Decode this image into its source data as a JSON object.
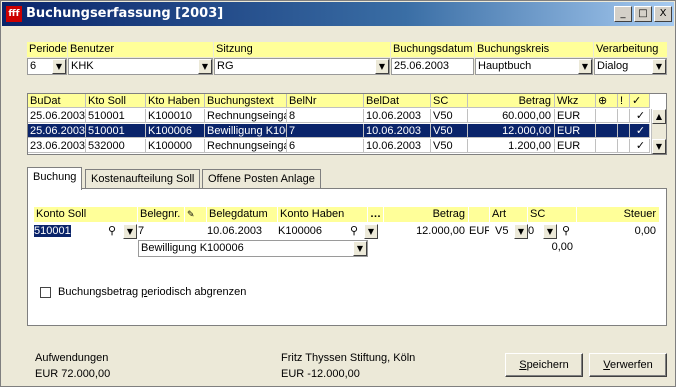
{
  "window": {
    "title": "Buchungserfassung [2003]",
    "app_icon": "fff"
  },
  "controls": {
    "minimize": "_",
    "maximize": "□",
    "close": "X"
  },
  "header": {
    "labels": [
      "Periode",
      "Benutzer",
      "Sitzung",
      "Buchungsdatum",
      "Buchungskreis",
      "Verarbeitung"
    ],
    "periode": "6",
    "benutzer": "KHK",
    "sitzung": "RG",
    "buchungsdatum": "25.06.2003",
    "buchungskreis": "Hauptbuch",
    "verarbeitung": "Dialog"
  },
  "grid": {
    "columns": [
      "BuDat",
      "Kto Soll",
      "Kto Haben",
      "Buchungstext",
      "BelNr",
      "BelDat",
      "SC",
      "Betrag",
      "Wkz",
      "⊕",
      "!",
      "✓"
    ],
    "rows": [
      [
        "25.06.2003",
        "510001",
        "K100010",
        "Rechnungseingan",
        "8",
        "10.06.2003",
        "V50",
        "60.000,00",
        "EUR",
        "",
        "",
        "✓"
      ],
      [
        "25.06.2003",
        "510001",
        "K100006",
        "Bewilligung K1000",
        "7",
        "10.06.2003",
        "V50",
        "12.000,00",
        "EUR",
        "",
        "",
        "✓"
      ],
      [
        "23.06.2003",
        "532000",
        "K100000",
        "Rechnungseingan",
        "6",
        "10.06.2003",
        "V50",
        "1.200,00",
        "EUR",
        "",
        "",
        "✓"
      ]
    ]
  },
  "tabs": [
    {
      "label": "Buchung"
    },
    {
      "label": "Kostenaufteilung Soll"
    },
    {
      "label": "Offene Posten Anlage"
    }
  ],
  "form": {
    "labels": {
      "konto_soll": "Konto Soll",
      "belegnr": "Belegnr.",
      "belegdatum": "Belegdatum",
      "konto_haben": "Konto Haben",
      "betrag": "Betrag",
      "art": "Art",
      "sc": "SC",
      "steuer": "Steuer"
    },
    "konto_soll": "510001",
    "belegnr": "7",
    "belegdatum": "10.06.2003",
    "konto_haben": "K100006",
    "betrag": "12.000,00",
    "wkz": "EUR",
    "art": "V5",
    "sc": "0",
    "steuer": "0,00",
    "buchungstext": "Bewilligung K100006",
    "sc_amount": "0,00",
    "checkbox_label_pre": "Buchungsbetrag ",
    "checkbox_label_u": "p",
    "checkbox_label_post": "eriodisch abgrenzen"
  },
  "footer": {
    "left_label": "Aufwendungen",
    "left_value": "EUR 72.000,00",
    "center_label": "Fritz Thyssen Stiftung, Köln",
    "center_value": "EUR -12.000,00",
    "save_u": "S",
    "save_rest": "peichern",
    "discard_u": "V",
    "discard_rest": "erwerfen"
  }
}
